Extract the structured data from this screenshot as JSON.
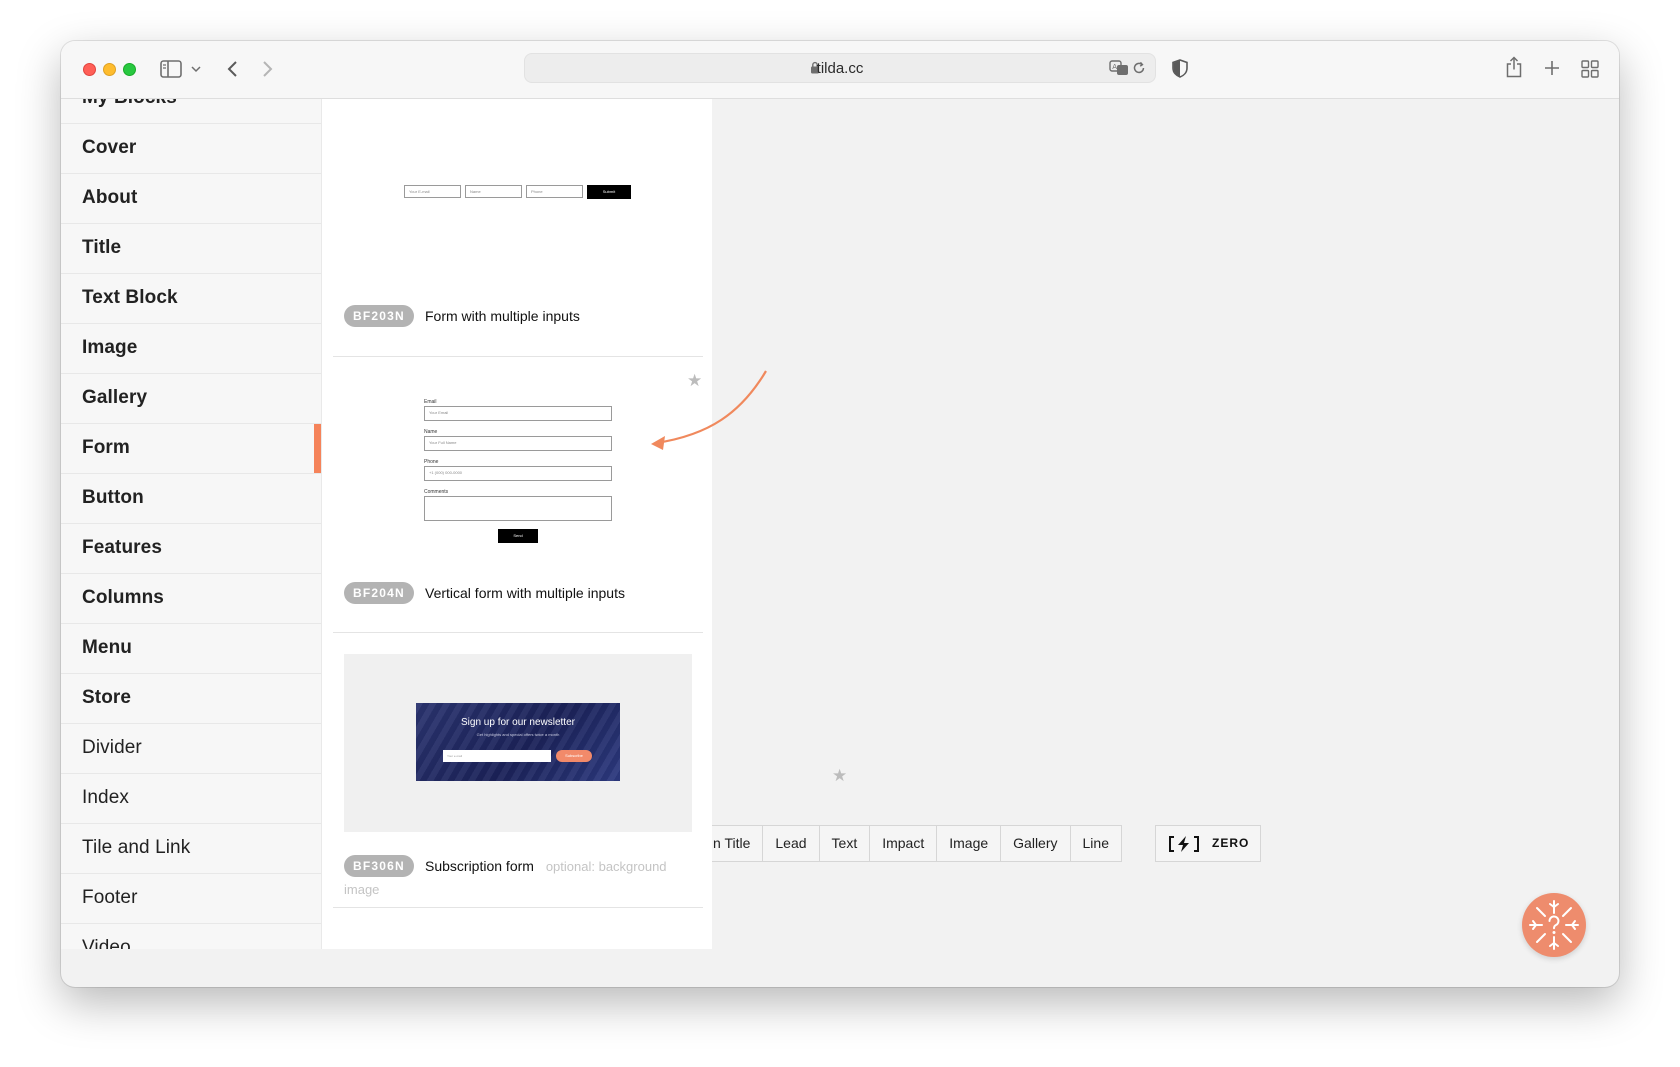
{
  "browser": {
    "url": "tilda.cc"
  },
  "sidebar": {
    "items": [
      {
        "label": "My Blocks",
        "weight": "bold"
      },
      {
        "label": "Cover",
        "weight": "bold"
      },
      {
        "label": "About",
        "weight": "bold"
      },
      {
        "label": "Title",
        "weight": "bold"
      },
      {
        "label": "Text Block",
        "weight": "bold"
      },
      {
        "label": "Image",
        "weight": "bold"
      },
      {
        "label": "Gallery",
        "weight": "bold"
      },
      {
        "label": "Form",
        "weight": "bold",
        "active": true
      },
      {
        "label": "Button",
        "weight": "bold"
      },
      {
        "label": "Features",
        "weight": "bold"
      },
      {
        "label": "Columns",
        "weight": "bold"
      },
      {
        "label": "Menu",
        "weight": "bold"
      },
      {
        "label": "Store",
        "weight": "bold"
      },
      {
        "label": "Divider",
        "weight": "normal"
      },
      {
        "label": "Index",
        "weight": "normal"
      },
      {
        "label": "Tile and Link",
        "weight": "normal"
      },
      {
        "label": "Footer",
        "weight": "normal"
      },
      {
        "label": "Video",
        "weight": "normal"
      }
    ],
    "accent_color": "#f5835a"
  },
  "blocks": [
    {
      "code": "BF203N",
      "title": "Form with multiple inputs",
      "preview": {
        "inputs": [
          "Your E-mail",
          "Name",
          "Phone"
        ],
        "button": "Submit"
      }
    },
    {
      "code": "BF204N",
      "title": "Vertical form with multiple inputs",
      "preview": {
        "fields": [
          {
            "label": "Email",
            "placeholder": "Your Email"
          },
          {
            "label": "Name",
            "placeholder": "Your Full Name"
          },
          {
            "label": "Phone",
            "placeholder": "+1 (000) 000-0000"
          },
          {
            "label": "Comments",
            "placeholder": ""
          }
        ],
        "button": "Send"
      }
    },
    {
      "code": "BF306N",
      "title": "Subscription form",
      "optional_1": "optional: background",
      "optional_2": "image",
      "preview": {
        "heading": "Sign up for our newsletter",
        "subheading": "Get highlights and special offers twice a month",
        "input": "Your e-mail",
        "button": "Subscribe"
      }
    }
  ],
  "quick_bar": {
    "items": [
      "Title",
      "Lead",
      "Text",
      "Impact",
      "Image",
      "Gallery",
      "Line"
    ],
    "partial_first_prefix": "n "
  },
  "zero_block": {
    "label": "ZERO"
  },
  "colors": {
    "accent": "#f5835a",
    "help_button": "#ee8c6d",
    "badge": "#b3b3b3"
  }
}
